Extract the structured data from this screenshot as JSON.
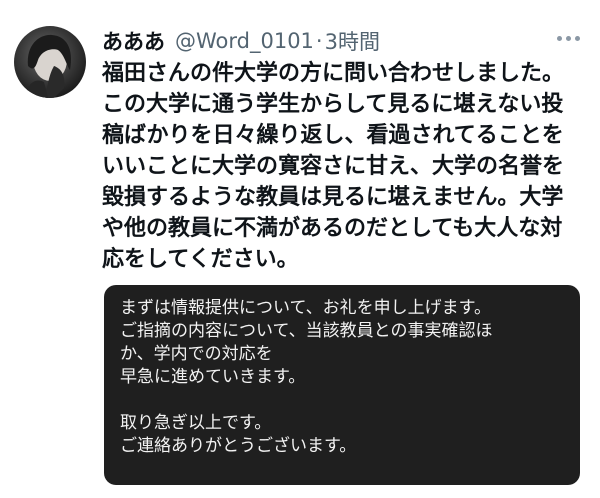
{
  "tweet": {
    "display_name": "あああ",
    "handle": "@Word_0101",
    "separator": "·",
    "timestamp": "3時間",
    "avatar_icon": "avatar-photo",
    "more_icon": "more-options-icon",
    "body_lines": [
      "福田さんの件大学の方に問い合わせしました。",
      "この大学に通う学生からして見るに堪えない投",
      "稿ばかりを日々繰り返し、看過されてることを",
      "いいことに大学の寛容さに甘え、大学の名誉を",
      "毀損するような教員は見るに堪えません。大学",
      "や他の教員に不満があるのだとしても大人な対",
      "応をしてください。"
    ]
  },
  "reply_image": {
    "lines": [
      "まずは情報提供について、お礼を申し上げます。",
      "ご指摘の内容について、当該教員との事実確認ほ",
      "か、学内での対応を",
      "早急に進めていきます。",
      "",
      "取り急ぎ以上です。",
      "ご連絡ありがとうございます。"
    ],
    "background_color": "#1f1f1f"
  }
}
